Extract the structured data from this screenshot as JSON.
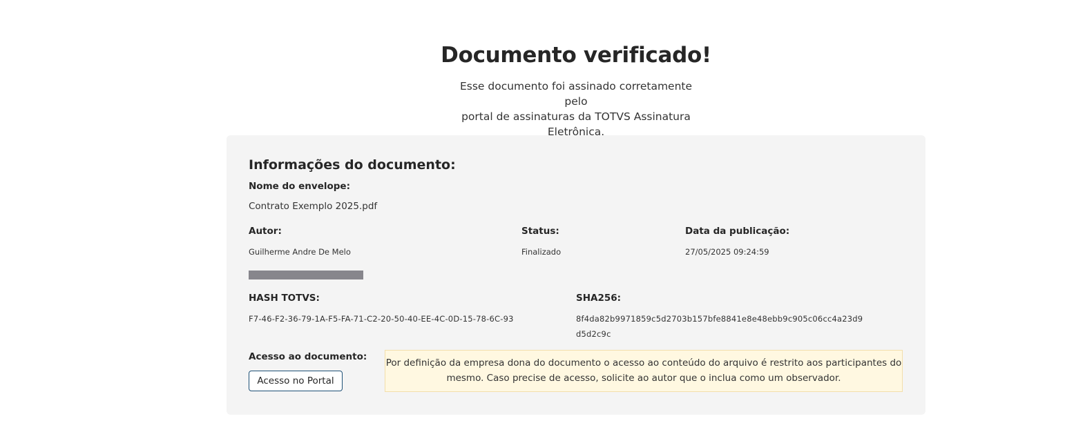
{
  "header": {
    "title": "Documento verificado!",
    "subtitle_lines": [
      "Esse documento foi assinado corretamente pelo",
      "portal de assinaturas da TOTVS Assinatura",
      "Eletrônica."
    ]
  },
  "document_info": {
    "section_title": "Informações do documento:",
    "envelope_name_label": "Nome do envelope:",
    "envelope_name": "Contrato Exemplo 2025.pdf",
    "author_label": "Autor:",
    "author": "Guilherme Andre De Melo",
    "status_label": "Status:",
    "status": "Finalizado",
    "publication_date_label": "Data da publicação:",
    "publication_date": "27/05/2025 09:24:59",
    "hash_totvs_label": "HASH TOTVS:",
    "hash_totvs": "F7-46-F2-36-79-1A-F5-FA-71-C2-20-50-40-EE-4C-0D-15-78-6C-93",
    "sha256_label": "SHA256:",
    "sha256_lines": [
      "8f4da82b9971859c5d2703b157bfe8841e8e48ebb9c905c06cc4a23d9",
      "d5d2c9c"
    ]
  },
  "access": {
    "label": "Acesso ao documento:",
    "portal_button": "Acesso no Portal",
    "notice_lines": [
      "Por definição da empresa dona do documento o acesso ao conteúdo do arquivo é restrito aos participantes do",
      "mesmo. Caso precise de acesso, solicite ao autor que o inclua como um observador."
    ]
  },
  "colors": {
    "card_background": "#f4f4f4",
    "notice_background": "#fff8e1",
    "notice_border": "#f3deaa",
    "button_border": "#1d4f75",
    "redaction_bar": "#87868c"
  }
}
